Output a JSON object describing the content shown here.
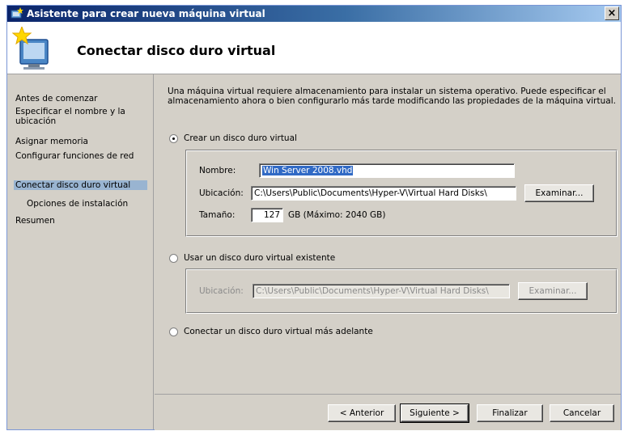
{
  "window": {
    "title": "Asistente para crear nueva máquina virtual",
    "close_label": "×"
  },
  "header": {
    "title": "Conectar disco duro virtual"
  },
  "sidebar": {
    "items": [
      {
        "label": "Antes de comenzar"
      },
      {
        "label": "Especificar el nombre y la ubicación"
      },
      {
        "label": "Asignar memoria"
      },
      {
        "label": "Configurar funciones de red"
      },
      {
        "label": "Conectar disco duro virtual",
        "active": true
      },
      {
        "label": "Opciones de instalación",
        "sub": true
      },
      {
        "label": "Resumen"
      }
    ]
  },
  "main": {
    "description": "Una máquina virtual requiere almacenamiento para instalar un sistema operativo. Puede especificar el almacenamiento ahora o bien configurarlo más tarde modificando las propiedades de la máquina virtual.",
    "option_create": {
      "label": "Crear un disco duro virtual",
      "selected": true,
      "name_label": "Nombre:",
      "name_value": "Win Server 2008.vhd",
      "location_label": "Ubicación:",
      "location_value": "C:\\Users\\Public\\Documents\\Hyper-V\\Virtual Hard Disks\\",
      "browse_label": "Examinar...",
      "size_label": "Tamaño:",
      "size_value": "127",
      "size_unit": "GB (Máximo: 2040 GB)"
    },
    "option_existing": {
      "label": "Usar un disco duro virtual existente",
      "selected": false,
      "location_label": "Ubicación:",
      "location_value": "C:\\Users\\Public\\Documents\\Hyper-V\\Virtual Hard Disks\\",
      "browse_label": "Examinar..."
    },
    "option_later": {
      "label": "Conectar un disco duro virtual más adelante",
      "selected": false
    }
  },
  "footer": {
    "back_label": "< Anterior",
    "next_label": "Siguiente >",
    "finish_label": "Finalizar",
    "cancel_label": "Cancelar"
  },
  "icons": {
    "app": "hyperv-wizard-icon",
    "header": "computer-star-icon",
    "close": "close-icon"
  }
}
